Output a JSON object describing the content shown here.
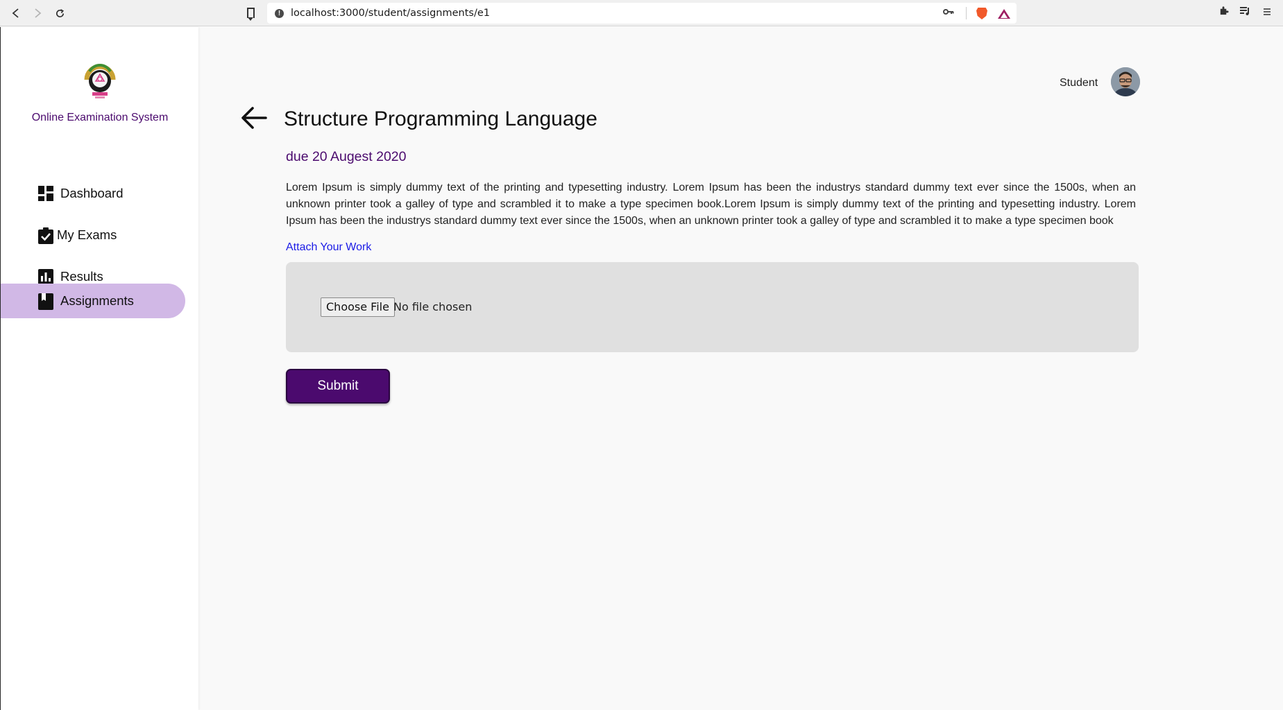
{
  "browser": {
    "url": "localhost:3000/student/assignments/e1"
  },
  "sidebar": {
    "app_name": "Online Examination System",
    "items": [
      {
        "label": "Dashboard",
        "icon": "dashboard-icon",
        "active": false
      },
      {
        "label": "My Exams",
        "icon": "clipboard-check-icon",
        "active": false
      },
      {
        "label": "Results",
        "icon": "bar-chart-icon",
        "active": false
      },
      {
        "label": "Assignments",
        "icon": "book-icon",
        "active": true
      }
    ]
  },
  "header": {
    "user_role": "Student"
  },
  "assignment": {
    "title": "Structure Programming Language",
    "due": "due 20 Augest 2020",
    "description": "Lorem Ipsum is simply dummy text of the printing and typesetting industry. Lorem Ipsum has been the industrys standard dummy text ever since the 1500s, when an unknown printer took a galley of type and scrambled it to make a type specimen book.Lorem Ipsum is simply dummy text of the printing and typesetting industry. Lorem Ipsum has been the industrys standard dummy text ever since the 1500s, when an unknown printer took a galley of type and scrambled it to make a type specimen book",
    "attach_label": "Attach Your Work",
    "choose_file_label": "Choose File",
    "file_status": "No file chosen",
    "submit_label": "Submit"
  },
  "colors": {
    "brand": "#4b0a6e",
    "active_nav": "#d1b8e6",
    "attach_link": "#1a1ae6"
  }
}
